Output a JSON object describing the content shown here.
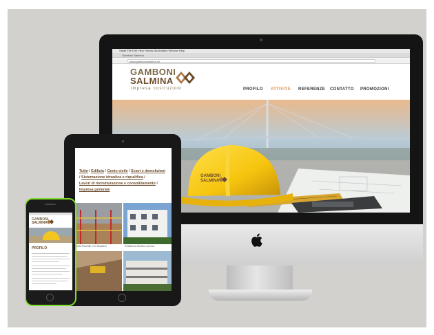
{
  "site": {
    "browser_menu": "Safari  File  Edit  View  History  Bookmarks  Window  Help",
    "tab_title": "Gamboni Salmina",
    "url": "www.gambonisalmina.ch",
    "brand": {
      "line1": "GAMBONI",
      "line2": "SALMINA",
      "tagline": "impresa costruzioni"
    },
    "nav": [
      "PROFILO",
      "ATTIVITÀ",
      "REFERENZE",
      "CONTATTO",
      "PROMOZIONI"
    ],
    "helmet_text": "GAMBONI\nSALMINA"
  },
  "tablet": {
    "links": [
      "Tutte",
      "Edilizia",
      "Genio civile",
      "Scavi e demolizioni",
      "Sistemazione idraulica e riqualifica",
      "Lavori di ristrutturazione e consolidamento",
      "Impresa generale"
    ],
    "caption_left": "Villa Pianellin Ceri Moabere",
    "caption_right": "Residenza Morbio Lucerna"
  },
  "phone": {
    "brand_line1": "GAMBONI",
    "brand_line2": "SALMINA",
    "section_title": "PROFILO"
  },
  "colors": {
    "brand_brown": "#6b4a2a",
    "brand_tan": "#b07a4a",
    "nav_active": "#d98c4a",
    "phone_frame": "#7ee02c",
    "background": "#d2d1cd"
  }
}
